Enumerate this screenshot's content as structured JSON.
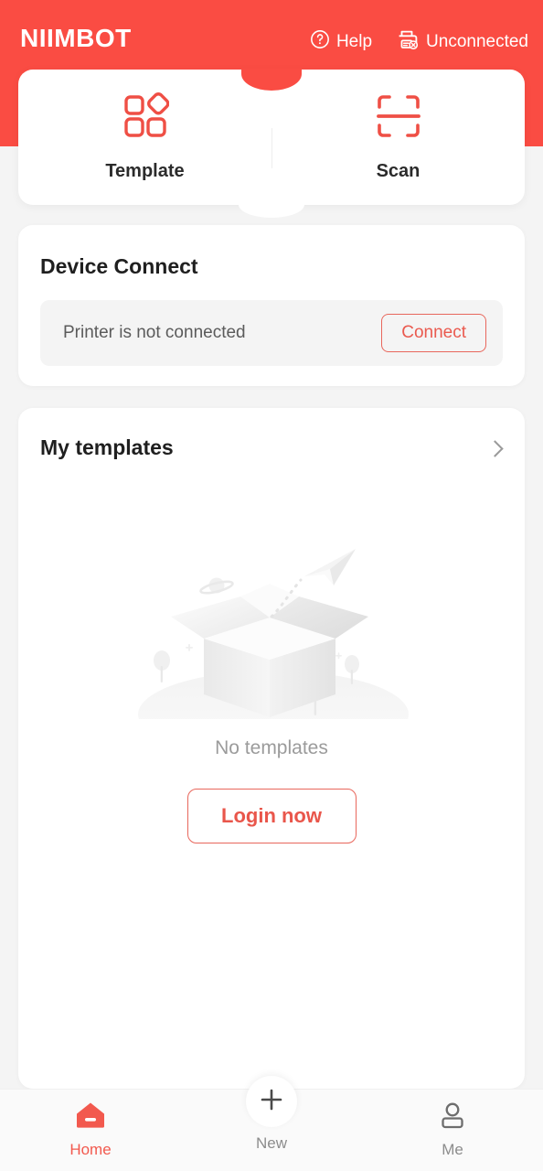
{
  "header": {
    "brand": "NIIMBOT",
    "help_label": "Help",
    "help_icon": "question-circle-icon",
    "connection_label": "Unconnected",
    "connection_icon": "printer-disconnected-icon",
    "background_color": "#fa4c43"
  },
  "tabs": [
    {
      "label": "Template",
      "icon": "template-grid-icon"
    },
    {
      "label": "Scan",
      "icon": "scan-frame-icon"
    }
  ],
  "device_connect": {
    "title": "Device Connect",
    "status_text": "Printer is not connected",
    "connect_button": "Connect",
    "accent_color": "#ea5a4f"
  },
  "my_templates": {
    "title": "My templates",
    "chevron_icon": "chevron-right-icon",
    "empty_illustration": "open-box-paper-plane-illustration",
    "empty_text": "No templates",
    "login_button": "Login now"
  },
  "bottom_nav": {
    "items": [
      {
        "label": "Home",
        "icon": "home-icon",
        "active": true
      },
      {
        "label": "Me",
        "icon": "person-icon",
        "active": false
      }
    ],
    "fab": {
      "label": "New",
      "icon": "plus-icon"
    },
    "active_color": "#f2594e",
    "inactive_color": "#8c8c8c"
  }
}
